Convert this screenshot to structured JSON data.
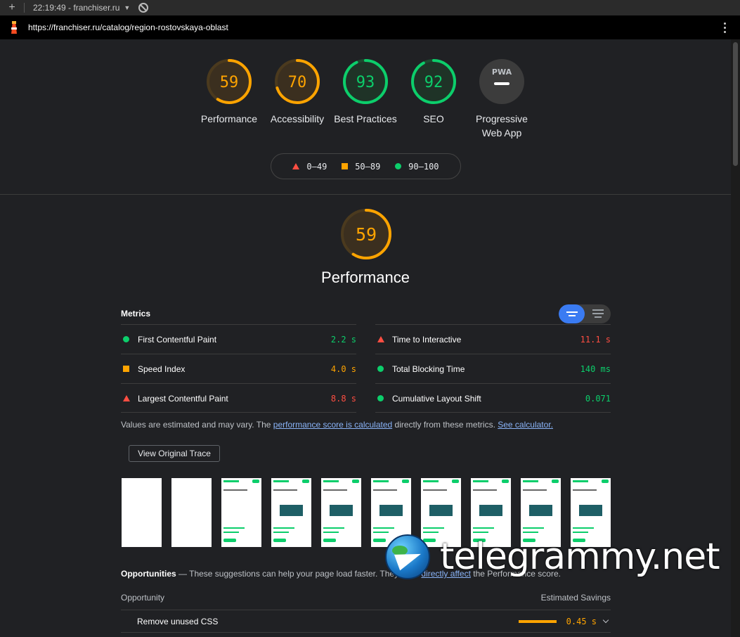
{
  "tab": {
    "title": "22:19:49 - franchiser.ru"
  },
  "url": "https://franchiser.ru/catalog/region-rostovskaya-oblast",
  "colors": {
    "fail": "#ff4e42",
    "average": "#ffa400",
    "pass": "#0cce6b",
    "accent": "#3a7bf2"
  },
  "scores": [
    {
      "label": "Performance",
      "value": "59",
      "score": 59,
      "rating": "average"
    },
    {
      "label": "Accessibility",
      "value": "70",
      "score": 70,
      "rating": "average"
    },
    {
      "label": "Best Practices",
      "value": "93",
      "score": 93,
      "rating": "pass"
    },
    {
      "label": "SEO",
      "value": "92",
      "score": 92,
      "rating": "pass"
    },
    {
      "label": "Progressive Web App",
      "badge": "PWA"
    }
  ],
  "legend": {
    "fail": "0–49",
    "average": "50–89",
    "pass": "90–100"
  },
  "performance": {
    "score": "59",
    "score_value": 59,
    "title": "Performance"
  },
  "metrics": {
    "title": "Metrics",
    "items": [
      {
        "name": "First Contentful Paint",
        "value": "2.2 s",
        "rating": "pass"
      },
      {
        "name": "Time to Interactive",
        "value": "11.1 s",
        "rating": "fail"
      },
      {
        "name": "Speed Index",
        "value": "4.0 s",
        "rating": "average"
      },
      {
        "name": "Total Blocking Time",
        "value": "140 ms",
        "rating": "pass"
      },
      {
        "name": "Largest Contentful Paint",
        "value": "8.8 s",
        "rating": "fail"
      },
      {
        "name": "Cumulative Layout Shift",
        "value": "0.071",
        "rating": "pass"
      }
    ]
  },
  "note": {
    "pre": "Values are estimated and may vary. The ",
    "link1": "performance score is calculated",
    "mid": " directly from these metrics. ",
    "link2": "See calculator."
  },
  "trace_button": "View Original Trace",
  "opportunities": {
    "title": "Opportunities",
    "desc_pre": " — These suggestions can help your page load faster. They don't ",
    "desc_link": "directly affect",
    "desc_post": " the Performance score.",
    "col_left": "Opportunity",
    "col_right": "Estimated Savings",
    "items": [
      {
        "name": "Remove unused CSS",
        "value": "0.45 s",
        "rating": "average"
      }
    ]
  },
  "watermark": "telegrammy.net"
}
